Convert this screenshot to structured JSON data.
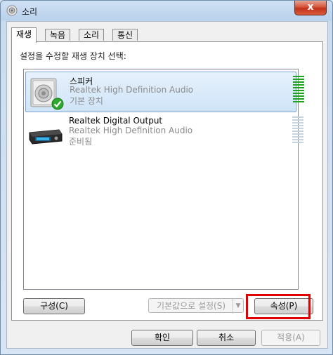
{
  "window": {
    "title": "소리",
    "close_label": "x"
  },
  "tabs": [
    {
      "label": "재생",
      "active": true
    },
    {
      "label": "녹음",
      "active": false
    },
    {
      "label": "소리",
      "active": false
    },
    {
      "label": "통신",
      "active": false
    }
  ],
  "playback": {
    "instructions": "설정을 수정할 재생 장치 선택:",
    "devices": [
      {
        "name": "스피커",
        "driver": "Realtek High Definition Audio",
        "status": "기본 장치",
        "selected": true,
        "icon": "speaker-icon",
        "default_check": "check-icon",
        "meter_color": "#1aa51a"
      },
      {
        "name": "Realtek Digital Output",
        "driver": "Realtek High Definition Audio",
        "status": "준비됨",
        "selected": false,
        "icon": "digital-output-icon",
        "meter_color": "#c7d3dc"
      }
    ]
  },
  "buttons": {
    "configure": "구성(C)",
    "set_default": "기본값으로 설정(S)",
    "properties": "속성(P)",
    "ok": "확인",
    "cancel": "취소",
    "apply": "적용(A)"
  },
  "highlight_color": "#e00000"
}
